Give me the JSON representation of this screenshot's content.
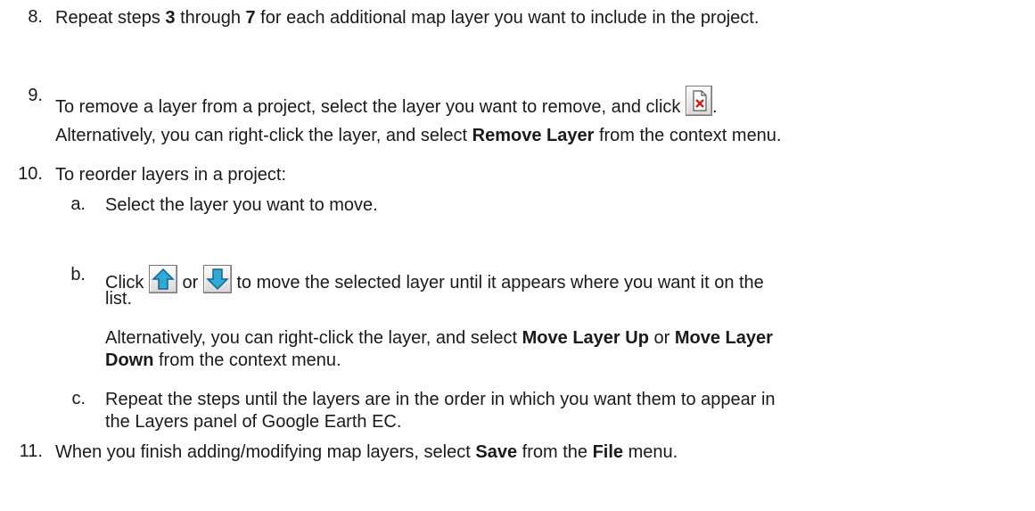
{
  "steps": {
    "s8": {
      "number": "8.",
      "t1": "Repeat steps ",
      "b1": "3",
      "t2": " through ",
      "b2": "7",
      "t3": " for each additional map layer you want to include in the project."
    },
    "s9": {
      "number": "9.",
      "t1": "To remove a layer from a project, select the layer you want to remove, and click ",
      "icon": "remove-layer-icon",
      "t2": ".",
      "alt_t1": "Alternatively, you can right-click the layer, and select ",
      "alt_b1": "Remove Layer",
      "alt_t2": " from the context menu."
    },
    "s10": {
      "number": "10.",
      "text": "To reorder layers in a project:",
      "a": {
        "letter": "a.",
        "text": "Select the layer you want to move."
      },
      "b": {
        "letter": "b.",
        "t1": "Click ",
        "icon_up": "move-up-arrow-icon",
        "t2": " or ",
        "icon_down": "move-down-arrow-icon",
        "t3": " to move the selected layer until it appears where you want it on the",
        "t4": "list.",
        "alt_t1": "Alternatively, you can right-click the layer, and select ",
        "alt_b1": "Move Layer Up",
        "alt_t2": " or ",
        "alt_b2": "Move Layer",
        "alt_b3": "Down",
        "alt_t3": " from the context menu."
      },
      "c": {
        "letter": "c.",
        "line1": "Repeat the steps until the layers are in the order in which you want them to appear in",
        "line2": "the Layers panel of Google Earth EC."
      }
    },
    "s11": {
      "number": "11.",
      "t1": "When you finish adding/modifying map layers, select ",
      "b1": "Save",
      "t2": " from the ",
      "b2": "File",
      "t3": " menu."
    }
  }
}
